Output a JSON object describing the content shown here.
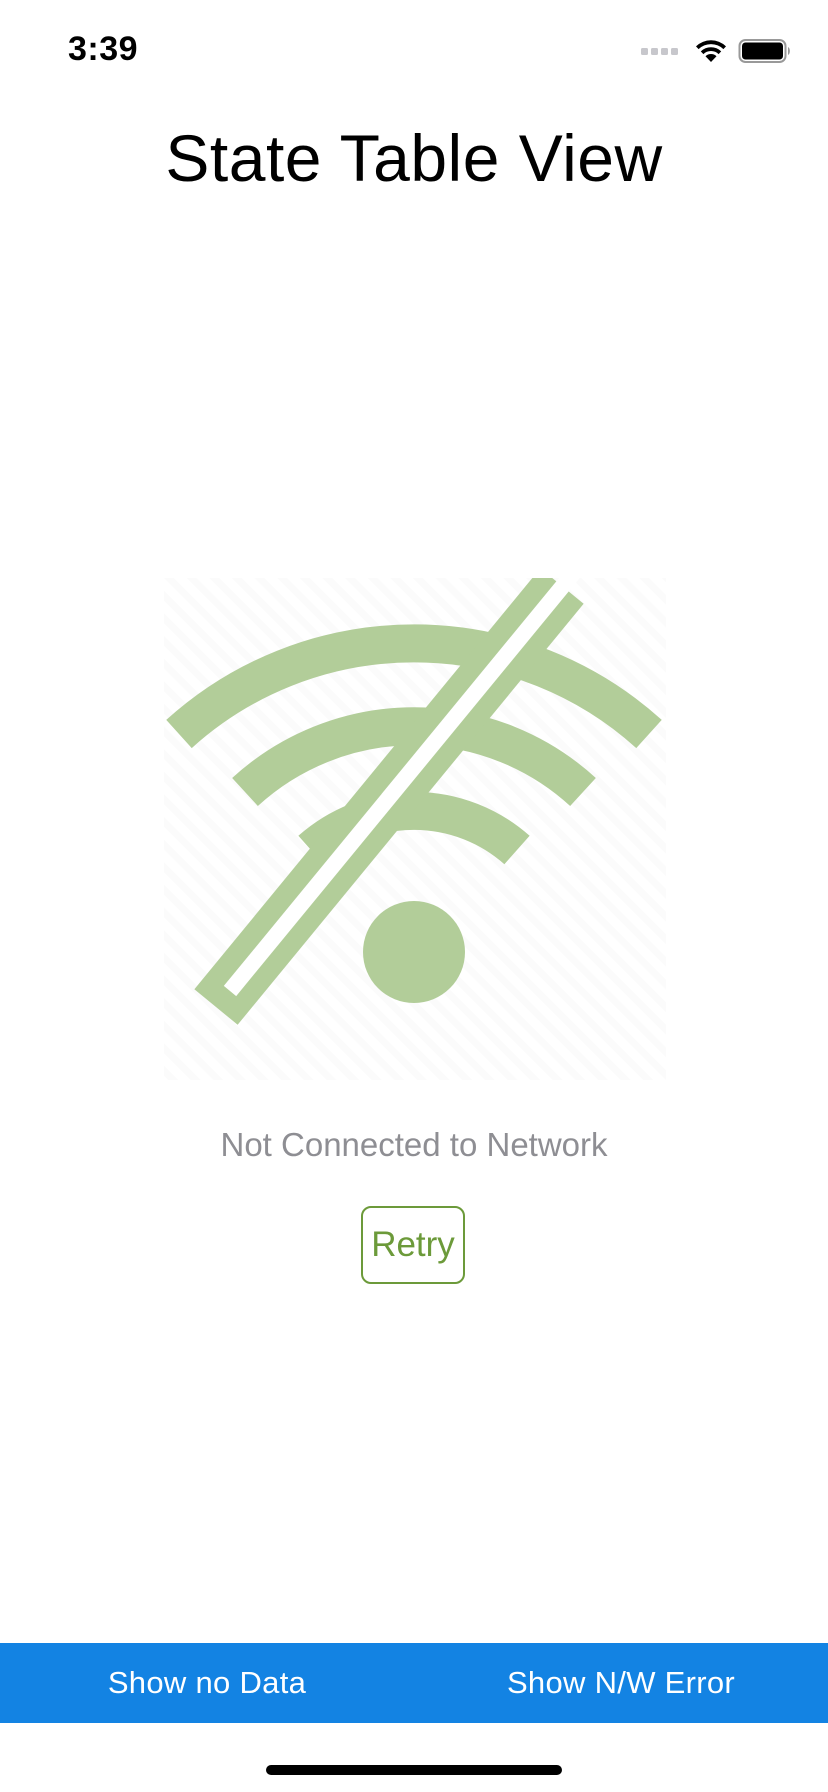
{
  "status_bar": {
    "time": "3:39",
    "icons": [
      "cellular-signal-icon",
      "wifi-icon",
      "battery-icon"
    ]
  },
  "header": {
    "title": "State Table View"
  },
  "empty_state": {
    "image_icon": "wifi-off-icon",
    "message": "Not Connected to Network",
    "retry_label": "Retry"
  },
  "toolbar": {
    "show_no_data_label": "Show no Data",
    "show_nw_error_label": "Show N/W Error"
  },
  "colors": {
    "accent_green": "#6c9a3a",
    "icon_green": "#b2cd99",
    "toolbar_blue": "#1383e3",
    "message_gray": "#8e8e93"
  }
}
